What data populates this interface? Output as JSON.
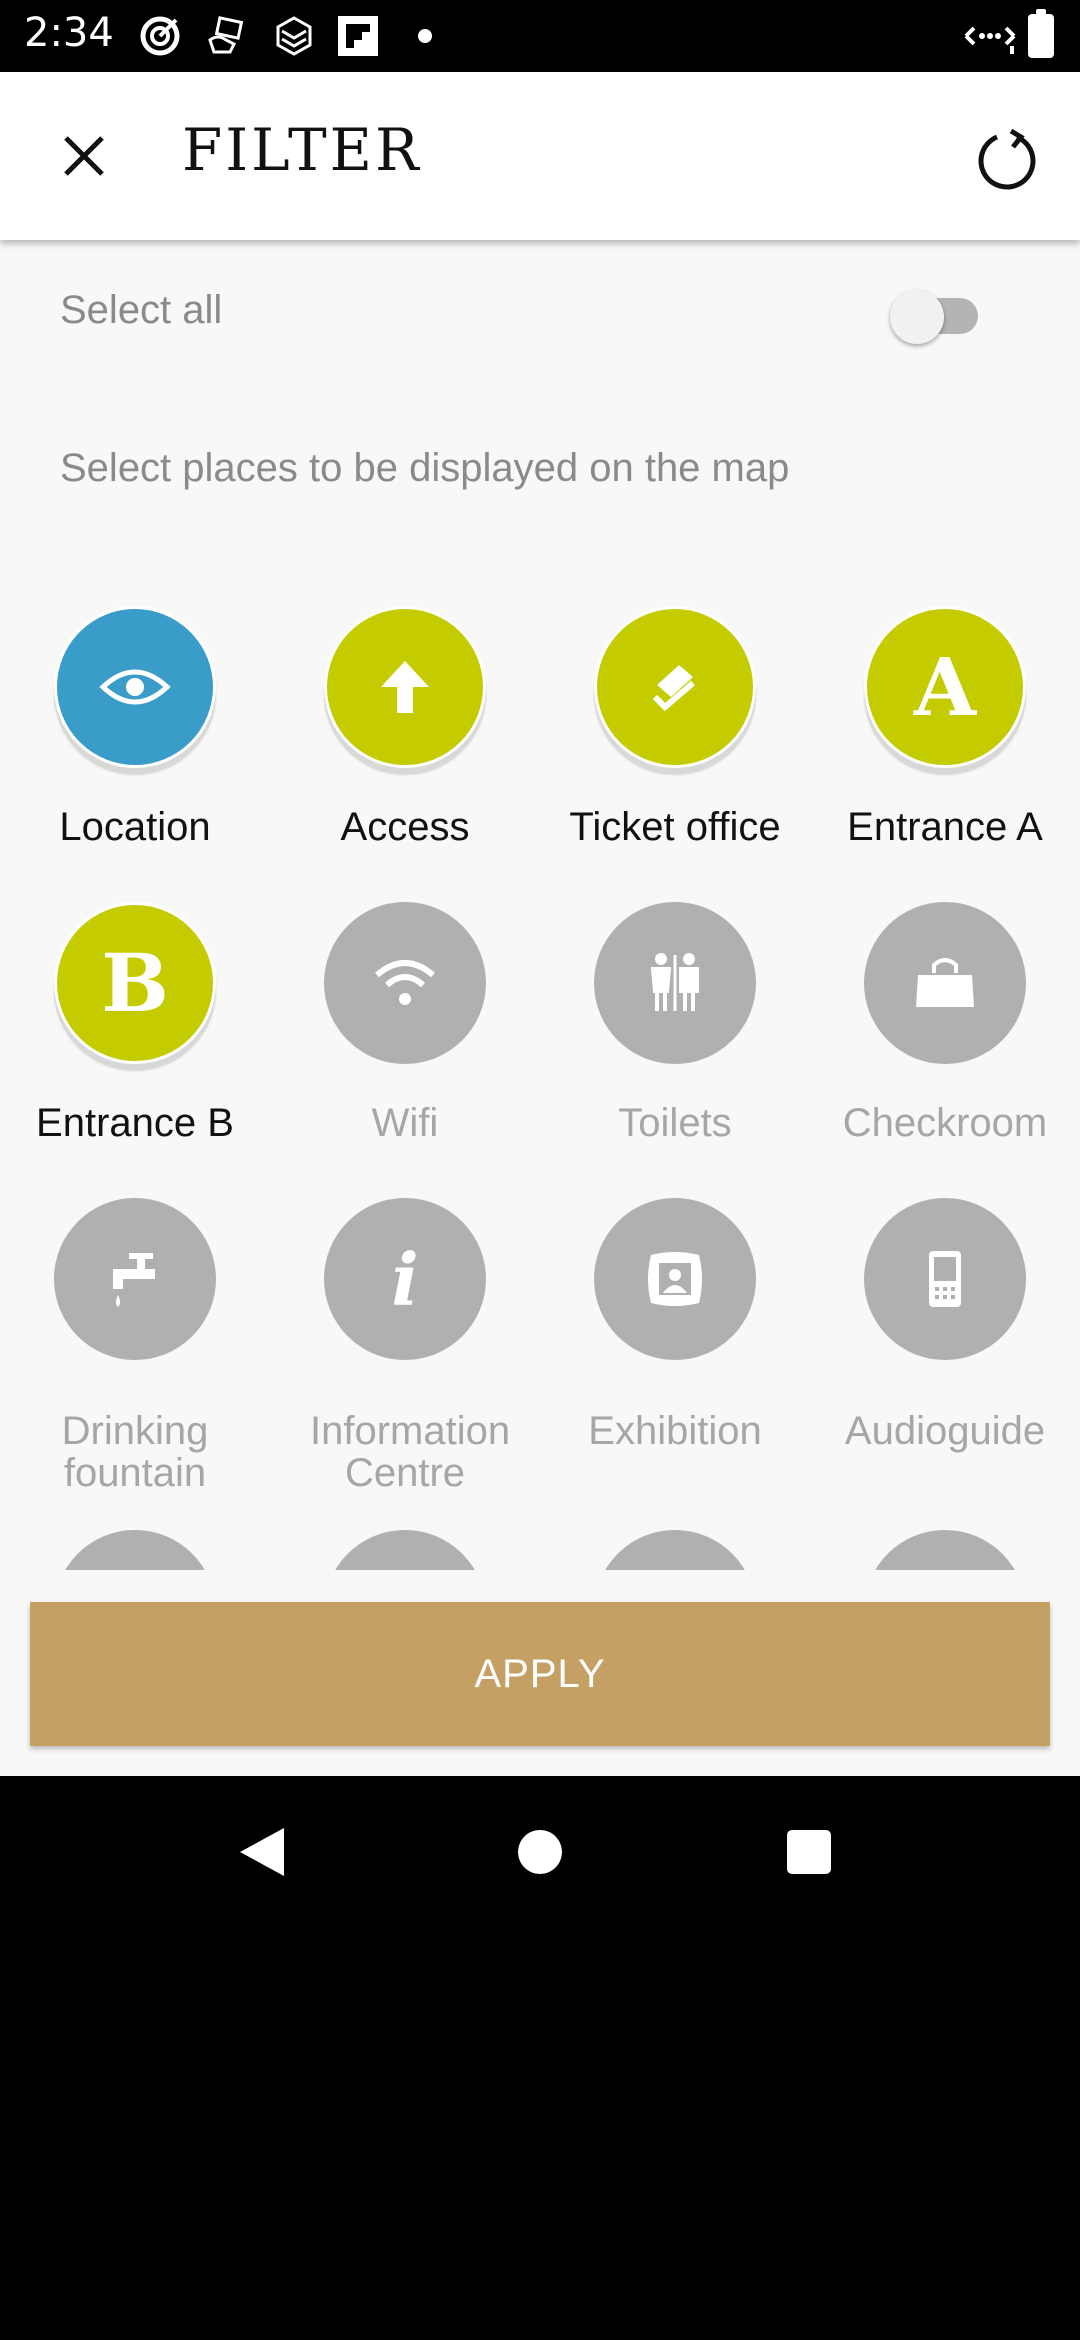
{
  "status_bar": {
    "time": "2:34",
    "icons": [
      "target-icon",
      "hand-card-icon",
      "layers-icon",
      "flipboard-icon",
      "notification-dot",
      "data-arrows-icon",
      "battery-icon"
    ]
  },
  "app_bar": {
    "title": "FILTER",
    "close_icon": "close-icon",
    "reset_icon": "refresh-icon"
  },
  "filter": {
    "select_all_label": "Select all",
    "select_all_on": false,
    "hint": "Select places to be displayed on the map",
    "items": [
      {
        "label": "Location",
        "icon": "eye-icon",
        "active": true,
        "color": "#3a9cc8"
      },
      {
        "label": "Access",
        "icon": "arrow-up-icon",
        "active": true,
        "color": "#c4cc00"
      },
      {
        "label": "Ticket office",
        "icon": "ticket-icon",
        "active": true,
        "color": "#c4cc00"
      },
      {
        "label": "Entrance A",
        "icon": "letter-a-icon",
        "glyph": "A",
        "active": true,
        "color": "#c4cc00"
      },
      {
        "label": "Entrance B",
        "icon": "letter-b-icon",
        "glyph": "B",
        "active": true,
        "color": "#c4cc00"
      },
      {
        "label": "Wifi",
        "icon": "wifi-icon",
        "active": false,
        "color": "#b0b0b0"
      },
      {
        "label": "Toilets",
        "icon": "toilets-icon",
        "active": false,
        "color": "#b0b0b0"
      },
      {
        "label": "Checkroom",
        "icon": "bag-icon",
        "active": false,
        "color": "#b0b0b0"
      },
      {
        "label": "Drinking fountain",
        "icon": "tap-icon",
        "active": false,
        "color": "#b0b0b0"
      },
      {
        "label": "Information Centre",
        "icon": "info-icon",
        "glyph": "i",
        "active": false,
        "color": "#b0b0b0"
      },
      {
        "label": "Exhibition",
        "icon": "portrait-frame-icon",
        "active": false,
        "color": "#b0b0b0"
      },
      {
        "label": "Audioguide",
        "icon": "phone-icon",
        "active": false,
        "color": "#b0b0b0"
      }
    ]
  },
  "apply_label": "APPLY"
}
